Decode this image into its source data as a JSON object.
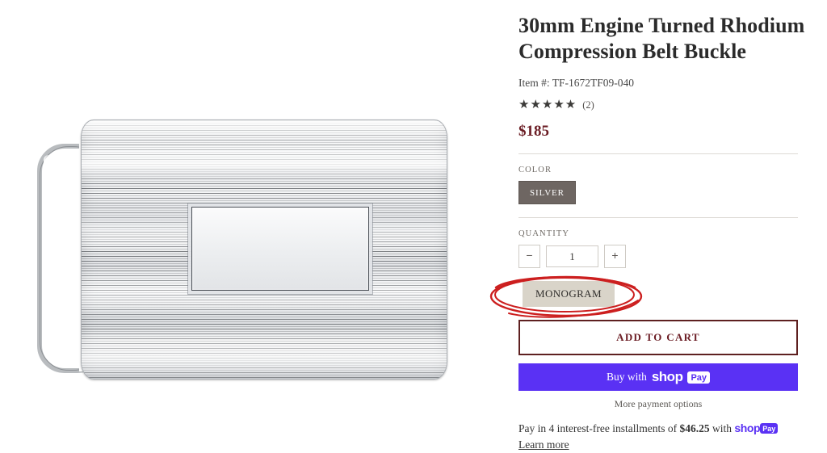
{
  "product": {
    "title": "30mm Engine Turned Rhodium Compression Belt Buckle",
    "item_number_label": "Item #: TF-1672TF09-040",
    "rating": {
      "stars": "★★★★★",
      "count_label": "(2)",
      "value": 5
    },
    "price": "$185"
  },
  "options": {
    "color_label": "COLOR",
    "color_selected": "SILVER",
    "quantity_label": "QUANTITY",
    "quantity_value": "1",
    "decrease_label": "−",
    "increase_label": "+",
    "monogram_label": "MONOGRAM"
  },
  "actions": {
    "add_to_cart": "ADD TO CART",
    "buy_with_prefix": "Buy with",
    "shop_word": "shop",
    "pay_badge": "Pay",
    "more_payment_options": "More payment options"
  },
  "financing": {
    "text_before": "Pay in 4 interest-free installments of",
    "amount": "$46.25",
    "text_with": "with",
    "shop_word": "shop",
    "pay_badge": "Pay",
    "learn_more": "Learn more"
  },
  "colors": {
    "price": "#6b1d24",
    "accent_border": "#5e2020",
    "swatch_bg": "#6e6662",
    "monogram_bg": "#d9d4c9",
    "shop_purple": "#5a31f4",
    "annotation_red": "#cc1f1f"
  },
  "image": {
    "alt": "Silver engine turned rhodium belt buckle with blank engravable center plaque"
  }
}
